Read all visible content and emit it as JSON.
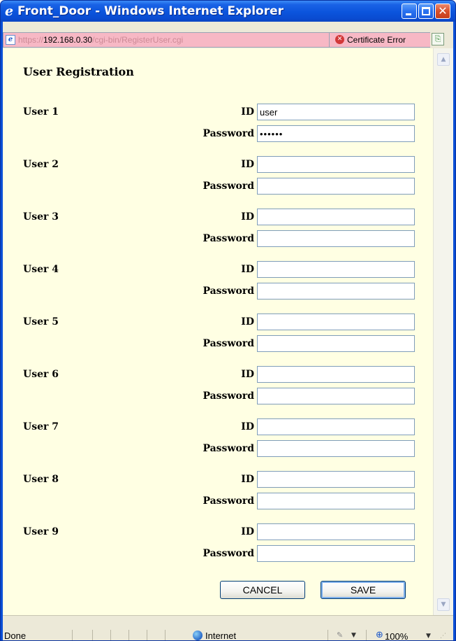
{
  "window": {
    "title": "Front_Door - Windows Internet Explorer"
  },
  "address": {
    "scheme": "https://",
    "host": "192.168.0.30",
    "path": "/cgi-bin/RegisterUser.cgi",
    "certificate_label": "Certificate Error"
  },
  "form": {
    "title": "User Registration",
    "id_label": "ID",
    "password_label": "Password",
    "users": [
      {
        "label": "User 1",
        "id_value": "user",
        "password_value": "••••••"
      },
      {
        "label": "User 2",
        "id_value": "",
        "password_value": ""
      },
      {
        "label": "User 3",
        "id_value": "",
        "password_value": ""
      },
      {
        "label": "User 4",
        "id_value": "",
        "password_value": ""
      },
      {
        "label": "User 5",
        "id_value": "",
        "password_value": ""
      },
      {
        "label": "User 6",
        "id_value": "",
        "password_value": ""
      },
      {
        "label": "User 7",
        "id_value": "",
        "password_value": ""
      },
      {
        "label": "User 8",
        "id_value": "",
        "password_value": ""
      },
      {
        "label": "User 9",
        "id_value": "",
        "password_value": ""
      }
    ],
    "cancel_label": "CANCEL",
    "save_label": "SAVE"
  },
  "status": {
    "text": "Done",
    "zone": "Internet",
    "zoom": "100%"
  },
  "icons": {
    "browser": "internet-explorer-icon",
    "page": "page-icon",
    "certificate": "certificate-error-icon",
    "compatibility": "compatibility-view-icon",
    "zone": "globe-icon",
    "zoom": "magnifier-icon"
  },
  "colors": {
    "titlebar": "#0b54dc",
    "address_error_bg": "#f7b8c5",
    "content_bg": "#ffffe3",
    "chrome_bg": "#ece9d8"
  }
}
